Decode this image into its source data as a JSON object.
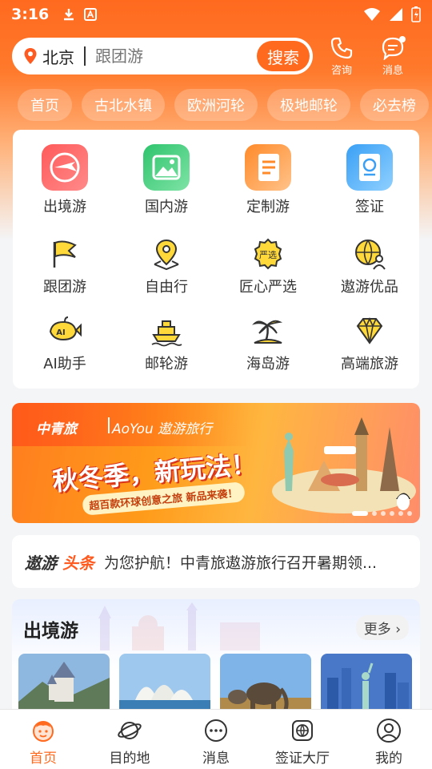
{
  "status_bar": {
    "time": "3:16"
  },
  "search": {
    "location": "北京",
    "placeholder": "跟团游",
    "button": "搜索"
  },
  "top_actions": [
    {
      "label": "咨询"
    },
    {
      "label": "消息"
    }
  ],
  "tags": [
    "首页",
    "古北水镇",
    "欧洲河轮",
    "极地邮轮",
    "必去榜"
  ],
  "grid": {
    "row1": [
      "出境游",
      "国内游",
      "定制游",
      "签证"
    ],
    "row2": [
      "跟团游",
      "自由行",
      "匠心严选",
      "遨游优品"
    ],
    "row3": [
      "AI助手",
      "邮轮游",
      "海岛游",
      "高端旅游"
    ]
  },
  "banner": {
    "brand_left": "中青旅",
    "brand_right": "AoYou 遨游旅行",
    "headline": "秋冬季，新玩法！",
    "subline": "超百款环球创意之旅 新品来袭！",
    "page_count": 6,
    "active_page": 1
  },
  "news": {
    "logo_a": "遨游",
    "logo_b": "头条",
    "text": "为您护航！中青旅遨游旅行召开暑期领..."
  },
  "section": {
    "title": "出境游",
    "more": "更多"
  },
  "bottom_nav": [
    "首页",
    "目的地",
    "消息",
    "签证大厅",
    "我的"
  ],
  "colors": {
    "brand_orange": "#ff6a1f"
  },
  "icons": {
    "grid": [
      "globe-plane-icon",
      "landscape-icon",
      "custom-doc-icon",
      "passport-icon",
      "flag-icon",
      "map-pin-icon",
      "quality-seal-icon",
      "globe-person-icon",
      "whale-ai-icon",
      "cruise-ship-icon",
      "palm-island-icon",
      "diamond-icon"
    ]
  }
}
